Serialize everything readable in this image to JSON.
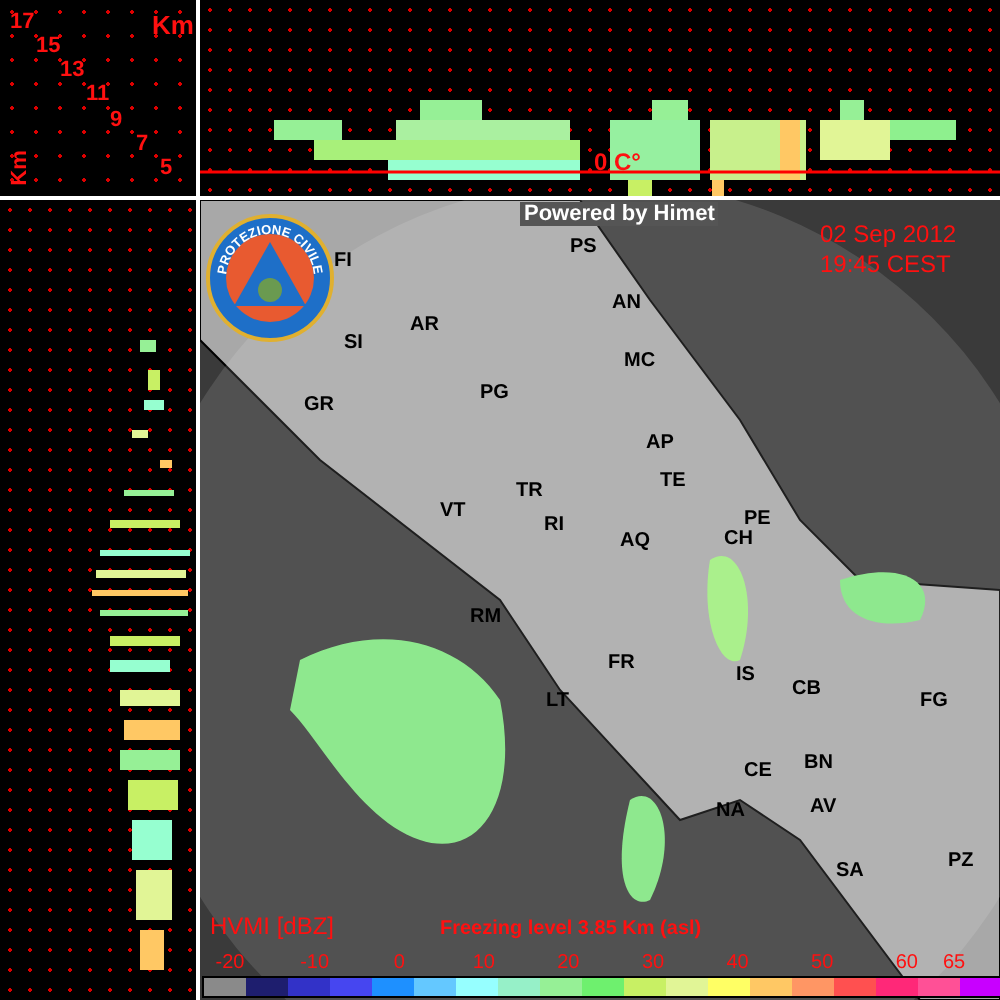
{
  "height_axis": {
    "unit_top": "Km",
    "unit_side": "Km",
    "ticks": [
      "17",
      "15",
      "13",
      "11",
      "9",
      "7",
      "5"
    ]
  },
  "top_profile": {
    "freezing_label": "0 C°"
  },
  "map": {
    "credit": "Powered by Himet",
    "date": "02 Sep 2012",
    "time": "19:45 CEST",
    "logo_text": "PROTEZIONE CIVILE",
    "cities": [
      {
        "name": "FI"
      },
      {
        "name": "PS"
      },
      {
        "name": "AN"
      },
      {
        "name": "SI"
      },
      {
        "name": "AR"
      },
      {
        "name": "MC"
      },
      {
        "name": "PG"
      },
      {
        "name": "AP"
      },
      {
        "name": "GR"
      },
      {
        "name": "TE"
      },
      {
        "name": "TR"
      },
      {
        "name": "VT"
      },
      {
        "name": "RI"
      },
      {
        "name": "AQ"
      },
      {
        "name": "PE"
      },
      {
        "name": "CH"
      },
      {
        "name": "RM"
      },
      {
        "name": "FR"
      },
      {
        "name": "IS"
      },
      {
        "name": "CB"
      },
      {
        "name": "FG"
      },
      {
        "name": "LT"
      },
      {
        "name": "CE"
      },
      {
        "name": "BN"
      },
      {
        "name": "NA"
      },
      {
        "name": "AV"
      },
      {
        "name": "SA"
      },
      {
        "name": "PZ"
      }
    ]
  },
  "legend": {
    "product": "HVMI [dBZ]",
    "freezing_level": "Freezing level  3.85 Km (asl)",
    "ticks": [
      "-20",
      "-10",
      "0",
      "10",
      "20",
      "30",
      "40",
      "50",
      "60",
      "65"
    ],
    "swatches": [
      {
        "color": "#8a8a8a"
      },
      {
        "color": "#1e1e6e"
      },
      {
        "color": "#3232c8"
      },
      {
        "color": "#4646f0"
      },
      {
        "color": "#1e90ff"
      },
      {
        "color": "#64c8ff"
      },
      {
        "color": "#96ffff"
      },
      {
        "color": "#96f0c8"
      },
      {
        "color": "#96f096"
      },
      {
        "color": "#6ef06e"
      },
      {
        "color": "#c8f064"
      },
      {
        "color": "#e1f596"
      },
      {
        "color": "#ffff64"
      },
      {
        "color": "#ffc864"
      },
      {
        "color": "#ff9664"
      },
      {
        "color": "#ff5050"
      },
      {
        "color": "#ff2878"
      },
      {
        "color": "#ff5096"
      },
      {
        "color": "#c800ff"
      }
    ]
  }
}
